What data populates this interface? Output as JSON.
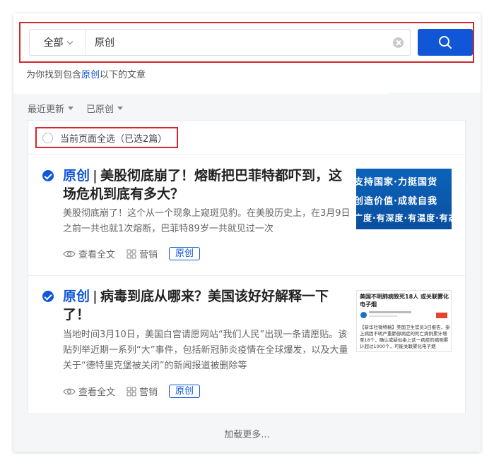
{
  "search": {
    "scope_label": "全部",
    "query": "原创",
    "placeholder": ""
  },
  "hint": {
    "prefix": "为你找到包含",
    "keyword": "原创",
    "suffix": "以下的文章"
  },
  "filters": [
    {
      "label": "最近更新"
    },
    {
      "label": "已原创"
    }
  ],
  "select_all": {
    "label": "当前页面全选（已选2篇）"
  },
  "articles": [
    {
      "tag": "原创",
      "separator": "|",
      "title": "美股彻底崩了！熔断把巴菲特都吓到，这场危机到底有多大？",
      "summary": "美股彻底崩了！这个从一个现象上窥斑见豹。在美股历史上，在3月9日之前一共也就1次熔断，巴菲特89岁一共就见过一次",
      "selected": true,
      "thumb_lines": [
        "支持国家·力挺国货",
        "创造价值·成就自我",
        "广度·有深度·有温度·有态"
      ],
      "actions": {
        "view": "查看全文",
        "marketing": "营销",
        "badge": "原创"
      }
    },
    {
      "tag": "原创",
      "separator": "|",
      "title": "病毒到底从哪来？美国该好好解释一下了！",
      "summary": "当地时间3月10日，美国白宫请愿网站“我们人民”出现一条请愿贴。该贴列举近期一系列“大”事件，包括新冠肺炎疫情在全球爆发，以及大量关于“德特里克堡被关闭”的新闻报道被删除等",
      "selected": true,
      "thumb_title": "美国不明肺病致死18人 或关联雾化电子烟",
      "thumb_text": "【新华社微特稿】美国卫生官员3日报告，染上病因不明严重肺部病症的死亡病例累计增至18个，确认或疑似染上这一病症的病例累计超过1000个，可能关联雾化电子烟",
      "actions": {
        "view": "查看全文",
        "marketing": "营销",
        "badge": "原创"
      }
    }
  ],
  "load_more": "加载更多...",
  "colors": {
    "accent": "#1256d8",
    "highlight_border": "#d0282e"
  },
  "icons": {
    "search": "search-icon",
    "clear": "clear-icon",
    "eye": "eye-icon",
    "grid": "grid-icon",
    "check": "check-circle-icon"
  }
}
